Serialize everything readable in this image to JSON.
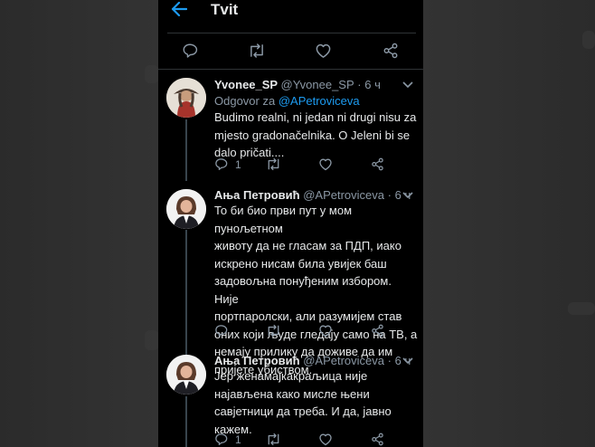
{
  "header": {
    "title": "Tvit"
  },
  "tweets": [
    {
      "name": "Yvonee_SP",
      "handle": "@Yvonee_SP",
      "time": "6 ч",
      "reply_prefix": "Odgovor za ",
      "reply_to": "@APetroviceva",
      "text": "Budimo realni, ni jedan ni drugi nisu za\nmjesto gradonačelnika.  O Jeleni bi se\ndalo pričati....",
      "reply_count": "1"
    },
    {
      "name": "Ања Петровић",
      "handle": "@APetroviceva",
      "time": "6 ч",
      "text": "То би био први пут у мом пунољетном\nживоту да не гласам за ПДП, иако\nискрено нисам била увијек баш\nзадовољна понуђеним избором. Није\nпортпаролски, али разумијем став\nоних који људе гледају само на ТВ, а\nнемају прилику да доживе да им\nпријете убиством.",
      "reply_count": ""
    },
    {
      "name": "Ања Петровић",
      "handle": "@APetroviceva",
      "time": "6 ч",
      "text": "Јер женамајкакраљица није\nнајављена како мисле њени\nсавјетници да треба. И да, јавно\nкажем.",
      "reply_count": "1"
    }
  ],
  "icons": {
    "back": "arrow-left-icon",
    "reply": "reply-icon",
    "retweet": "retweet-icon",
    "like": "heart-icon",
    "share": "share-icon",
    "more": "chevron-down-icon"
  },
  "colors": {
    "accent": "#1d9bf0",
    "background": "#000000",
    "text": "#e7e9ea",
    "muted": "#8b98a5"
  }
}
